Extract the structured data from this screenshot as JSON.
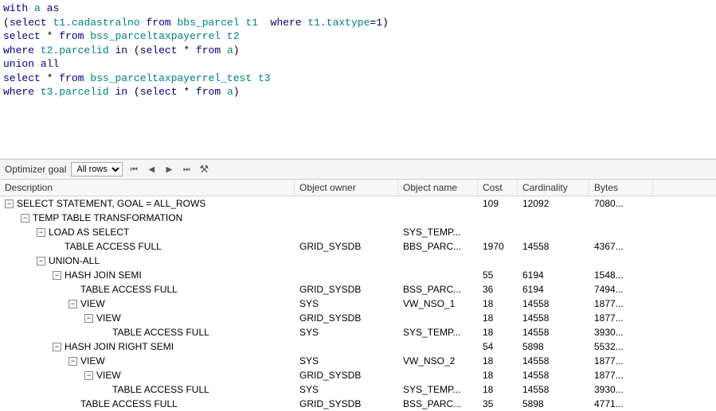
{
  "sql": {
    "tokens": [
      [
        [
          "kw",
          "with"
        ],
        [
          "",
          ""
        ],
        [
          "ident",
          "a"
        ],
        [
          "",
          ""
        ],
        [
          "kw",
          "as"
        ]
      ],
      [
        [
          "op",
          "("
        ],
        [
          "kw",
          "select"
        ],
        [
          "",
          ""
        ],
        [
          "ident",
          "t1.cadastralno"
        ],
        [
          "",
          ""
        ],
        [
          "kw",
          "from"
        ],
        [
          "",
          ""
        ],
        [
          "ident",
          "bbs_parcel"
        ],
        [
          "",
          ""
        ],
        [
          "ident",
          "t1"
        ],
        [
          "",
          "  "
        ],
        [
          "kw",
          "where"
        ],
        [
          "",
          ""
        ],
        [
          "ident",
          "t1.taxtype"
        ],
        [
          "op",
          "="
        ],
        [
          "num",
          "1"
        ],
        [
          "op",
          ")"
        ]
      ],
      [
        [
          "kw",
          "select"
        ],
        [
          "",
          ""
        ],
        [
          "op",
          "*"
        ],
        [
          "",
          ""
        ],
        [
          "kw",
          "from"
        ],
        [
          "",
          ""
        ],
        [
          "ident",
          "bss_parceltaxpayerrel"
        ],
        [
          "",
          ""
        ],
        [
          "ident",
          "t2"
        ]
      ],
      [
        [
          "kw",
          "where"
        ],
        [
          "",
          ""
        ],
        [
          "ident",
          "t2.parcelid"
        ],
        [
          "",
          ""
        ],
        [
          "kw",
          "in"
        ],
        [
          "",
          ""
        ],
        [
          "op",
          "("
        ],
        [
          "kw",
          "select"
        ],
        [
          "",
          ""
        ],
        [
          "op",
          "*"
        ],
        [
          "",
          ""
        ],
        [
          "kw",
          "from"
        ],
        [
          "",
          ""
        ],
        [
          "ident",
          "a"
        ],
        [
          "op",
          ")"
        ]
      ],
      [
        [
          "kw",
          "union"
        ],
        [
          "",
          ""
        ],
        [
          "kw",
          "all"
        ]
      ],
      [
        [
          "kw",
          "select"
        ],
        [
          "",
          ""
        ],
        [
          "op",
          "*"
        ],
        [
          "",
          ""
        ],
        [
          "kw",
          "from"
        ],
        [
          "",
          ""
        ],
        [
          "ident",
          "bss_parceltaxpayerrel_test"
        ],
        [
          "",
          ""
        ],
        [
          "ident",
          "t3"
        ]
      ],
      [
        [
          "kw",
          "where"
        ],
        [
          "",
          ""
        ],
        [
          "ident",
          "t3.parcelid"
        ],
        [
          "",
          ""
        ],
        [
          "kw",
          "in"
        ],
        [
          "",
          ""
        ],
        [
          "op",
          "("
        ],
        [
          "kw",
          "select"
        ],
        [
          "",
          ""
        ],
        [
          "op",
          "*"
        ],
        [
          "",
          ""
        ],
        [
          "kw",
          "from"
        ],
        [
          "",
          ""
        ],
        [
          "ident",
          "a"
        ],
        [
          "op",
          ")"
        ]
      ]
    ]
  },
  "toolbar": {
    "optimizer_label": "Optimizer goal",
    "optimizer_value": "All rows"
  },
  "columns": {
    "desc": "Description",
    "owner": "Object owner",
    "objname": "Object name",
    "cost": "Cost",
    "card": "Cardinality",
    "bytes": "Bytes"
  },
  "plan": [
    {
      "indent": 0,
      "toggle": "-",
      "desc": "SELECT STATEMENT, GOAL = ALL_ROWS",
      "owner": "",
      "objname": "",
      "cost": "109",
      "card": "12092",
      "bytes": "7080..."
    },
    {
      "indent": 1,
      "toggle": "-",
      "desc": "TEMP TABLE TRANSFORMATION",
      "owner": "",
      "objname": "",
      "cost": "",
      "card": "",
      "bytes": ""
    },
    {
      "indent": 2,
      "toggle": "-",
      "desc": "LOAD AS SELECT",
      "owner": "",
      "objname": "SYS_TEMP...",
      "cost": "",
      "card": "",
      "bytes": ""
    },
    {
      "indent": 3,
      "toggle": "",
      "desc": "TABLE ACCESS FULL",
      "owner": "GRID_SYSDB",
      "objname": "BBS_PARC...",
      "cost": "1970",
      "card": "14558",
      "bytes": "4367..."
    },
    {
      "indent": 2,
      "toggle": "-",
      "desc": "UNION-ALL",
      "owner": "",
      "objname": "",
      "cost": "",
      "card": "",
      "bytes": ""
    },
    {
      "indent": 3,
      "toggle": "-",
      "desc": "HASH JOIN SEMI",
      "owner": "",
      "objname": "",
      "cost": "55",
      "card": "6194",
      "bytes": "1548..."
    },
    {
      "indent": 4,
      "toggle": "",
      "desc": "TABLE ACCESS FULL",
      "owner": "GRID_SYSDB",
      "objname": "BSS_PARC...",
      "cost": "36",
      "card": "6194",
      "bytes": "7494..."
    },
    {
      "indent": 4,
      "toggle": "-",
      "desc": "VIEW",
      "owner": "SYS",
      "objname": "VW_NSO_1",
      "cost": "18",
      "card": "14558",
      "bytes": "1877..."
    },
    {
      "indent": 5,
      "toggle": "-",
      "desc": "VIEW",
      "owner": "GRID_SYSDB",
      "objname": "",
      "cost": "18",
      "card": "14558",
      "bytes": "1877..."
    },
    {
      "indent": 6,
      "toggle": "",
      "desc": "TABLE ACCESS FULL",
      "owner": "SYS",
      "objname": "SYS_TEMP...",
      "cost": "18",
      "card": "14558",
      "bytes": "3930..."
    },
    {
      "indent": 3,
      "toggle": "-",
      "desc": "HASH JOIN RIGHT SEMI",
      "owner": "",
      "objname": "",
      "cost": "54",
      "card": "5898",
      "bytes": "5532..."
    },
    {
      "indent": 4,
      "toggle": "-",
      "desc": "VIEW",
      "owner": "SYS",
      "objname": "VW_NSO_2",
      "cost": "18",
      "card": "14558",
      "bytes": "1877..."
    },
    {
      "indent": 5,
      "toggle": "-",
      "desc": "VIEW",
      "owner": "GRID_SYSDB",
      "objname": "",
      "cost": "18",
      "card": "14558",
      "bytes": "1877..."
    },
    {
      "indent": 6,
      "toggle": "",
      "desc": "TABLE ACCESS FULL",
      "owner": "SYS",
      "objname": "SYS_TEMP...",
      "cost": "18",
      "card": "14558",
      "bytes": "3930..."
    },
    {
      "indent": 4,
      "toggle": "",
      "desc": "TABLE ACCESS FULL",
      "owner": "GRID_SYSDB",
      "objname": "BSS_PARC...",
      "cost": "35",
      "card": "5898",
      "bytes": "4771..."
    }
  ]
}
